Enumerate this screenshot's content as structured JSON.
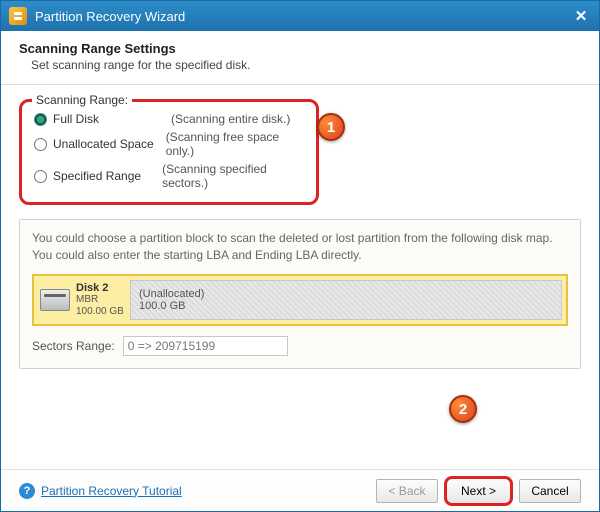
{
  "window": {
    "title": "Partition Recovery Wizard"
  },
  "header": {
    "title": "Scanning Range Settings",
    "subtitle": "Set scanning range for the specified disk."
  },
  "scanning_range": {
    "legend": "Scanning Range:",
    "selected": "full",
    "options": [
      {
        "id": "full",
        "label": "Full Disk",
        "desc": "(Scanning entire disk.)"
      },
      {
        "id": "unallocated",
        "label": "Unallocated Space",
        "desc": "(Scanning free space only.)"
      },
      {
        "id": "specified",
        "label": "Specified Range",
        "desc": "(Scanning specified sectors.)"
      }
    ]
  },
  "panel": {
    "hint": "You could choose a partition block to scan the deleted or lost partition from the following disk map. You could also enter the starting LBA and Ending LBA directly.",
    "disk": {
      "name": "Disk 2",
      "type": "MBR",
      "size": "100.00 GB"
    },
    "block": {
      "label": "(Unallocated)",
      "size": "100.0 GB"
    },
    "sectors_label": "Sectors Range:",
    "sectors_value": "0 => 209715199"
  },
  "footer": {
    "help_link": "Partition Recovery Tutorial",
    "back": "< Back",
    "next": "Next >",
    "cancel": "Cancel"
  },
  "callouts": {
    "one": "1",
    "two": "2"
  }
}
